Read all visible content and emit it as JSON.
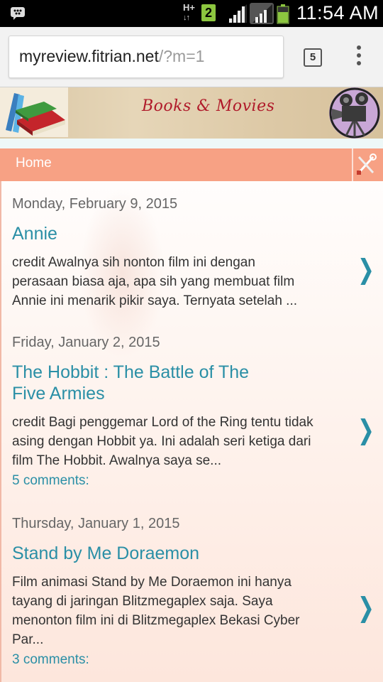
{
  "status_bar": {
    "network": "H+",
    "notification_count": "2",
    "time": "11:54 AM",
    "icons": [
      "bbm-icon",
      "data-transfer-icon",
      "signal-icon",
      "signal-icon",
      "battery-icon"
    ]
  },
  "browser": {
    "url_host": "myreview.fitrian.net",
    "url_path": "/?m=1",
    "tab_count": "5",
    "icons": [
      "tabs-icon",
      "overflow-menu-icon"
    ]
  },
  "blog": {
    "title": "Books & Movies",
    "nav": {
      "home": "Home"
    },
    "icons": [
      "books-icon",
      "camera-icon",
      "tools-icon",
      "chevron-right-icon"
    ]
  },
  "posts": [
    {
      "date": "Monday, February 9, 2015",
      "title_lines": [
        "Annie"
      ],
      "snippet_lines": [
        "credit Awalnya sih nonton film ini dengan",
        "perasaan biasa aja, apa sih yang membuat film",
        "Annie ini menarik pikir saya. Ternyata setelah ..."
      ],
      "comments": ""
    },
    {
      "date": "Friday, January 2, 2015",
      "title_lines": [
        "The Hobbit : The Battle of The",
        "Five Armies"
      ],
      "snippet_lines": [
        "credit Bagi penggemar Lord of the Ring tentu tidak",
        "asing dengan Hobbit ya. Ini adalah seri ketiga dari",
        "film The Hobbit. Awalnya saya se..."
      ],
      "comments": "5 comments:"
    },
    {
      "date": "Thursday, January 1, 2015",
      "title_lines": [
        "Stand by Me Doraemon"
      ],
      "snippet_lines": [
        "Film animasi Stand by Me Doraemon ini hanya",
        "tayang di jaringan Blitzmegaplex saja. Saya",
        "menonton film ini di Blitzmegaplex Bekasi Cyber",
        "Par..."
      ],
      "comments": "3 comments:"
    }
  ],
  "arrow_glyph": "❯"
}
